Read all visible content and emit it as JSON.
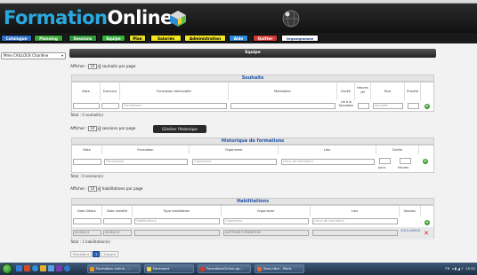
{
  "header": {
    "title_part1": "Formation",
    "title_part2": "Online"
  },
  "nav": [
    {
      "label": "Catalogue",
      "bg": "#2e6fc4",
      "fg": "#ffffff"
    },
    {
      "label": "Planning",
      "bg": "#3aa33a",
      "fg": "#ffffff"
    },
    {
      "label": "Sessions",
      "bg": "#2f9a3c",
      "fg": "#ffffff"
    },
    {
      "label": "Equipe",
      "bg": "#36b03c",
      "fg": "#ffffff"
    },
    {
      "label": "Plan",
      "bg": "#e7df2a",
      "fg": "#000000"
    },
    {
      "label": "Salariés",
      "bg": "#f3e623",
      "fg": "#000000"
    },
    {
      "label": "Administration",
      "bg": "#f0e52a",
      "fg": "#000000"
    },
    {
      "label": "Aide",
      "bg": "#2d8bd6",
      "fg": "#ffffff"
    },
    {
      "label": "Quitter",
      "bg": "#d23a3a",
      "fg": "#ffffff"
    },
    {
      "label": "Organigramme",
      "bg": "#ffffff",
      "fg": "#1c3f8a"
    }
  ],
  "user_select": {
    "value": "Mme CAILLOUX Charlène"
  },
  "equipe": {
    "title": "Equipe"
  },
  "souhaits": {
    "afficher_prefix": "Afficher :",
    "page_size": "10",
    "afficher_suffix": "souhaits par page",
    "title": "Souhaits",
    "columns": [
      "Date",
      "Exercice",
      "Formation demandée",
      "Motivation",
      "Durée",
      "Heures dif",
      "Etat",
      "Priorité"
    ],
    "input_duree": "Lié à la formation",
    "placeholder_formation": "Formations",
    "placeholder_etat": "Accepté",
    "total": "Total : 0 souhait(s)"
  },
  "historique": {
    "afficher_prefix": "Afficher :",
    "page_size": "10",
    "afficher_suffix": "sessions par page",
    "button": "Générer l'historique",
    "title": "Historique de formations",
    "columns": [
      "Date",
      "Formation",
      "Organisme",
      "Lieu",
      "Durée"
    ],
    "placeholder_formation": "Formations",
    "placeholder_organisme": "Organisme",
    "placeholder_lieu": "Lieux de formation",
    "duree_units": [
      "Jours",
      "Heures"
    ],
    "total": "Total : 0 session(s)"
  },
  "habilitations": {
    "afficher_prefix": "Afficher :",
    "page_size": "10",
    "afficher_suffix": "habilitations par page",
    "title": "Habilitations",
    "columns": [
      "Date Début",
      "Date validité",
      "Type habilitation",
      "Organisme",
      "Lieu",
      "Session"
    ],
    "placeholder_type": "Habilitations",
    "placeholder_organisme": "Organisme",
    "placeholder_lieu": "Lieux de formation",
    "rows": [
      {
        "date_debut": "02/04/13",
        "date_validite": "02/04/13",
        "type": "",
        "organisme": "ALTITUDE FORMATION",
        "lieu": "",
        "session": "2013-04003"
      }
    ],
    "total": "Total : 1 habilitation(s)"
  },
  "pager": {
    "prev": "Précédent",
    "page": "1",
    "next": "Suivant"
  },
  "taskbar": {
    "tasks": [
      {
        "label": "Formation online - ..."
      },
      {
        "label": "Formonet"
      },
      {
        "label": "FormationOnline.pp..."
      },
      {
        "label": "Sans titre - Paint"
      }
    ],
    "tray_lang": "FR",
    "clock": "15:32"
  }
}
